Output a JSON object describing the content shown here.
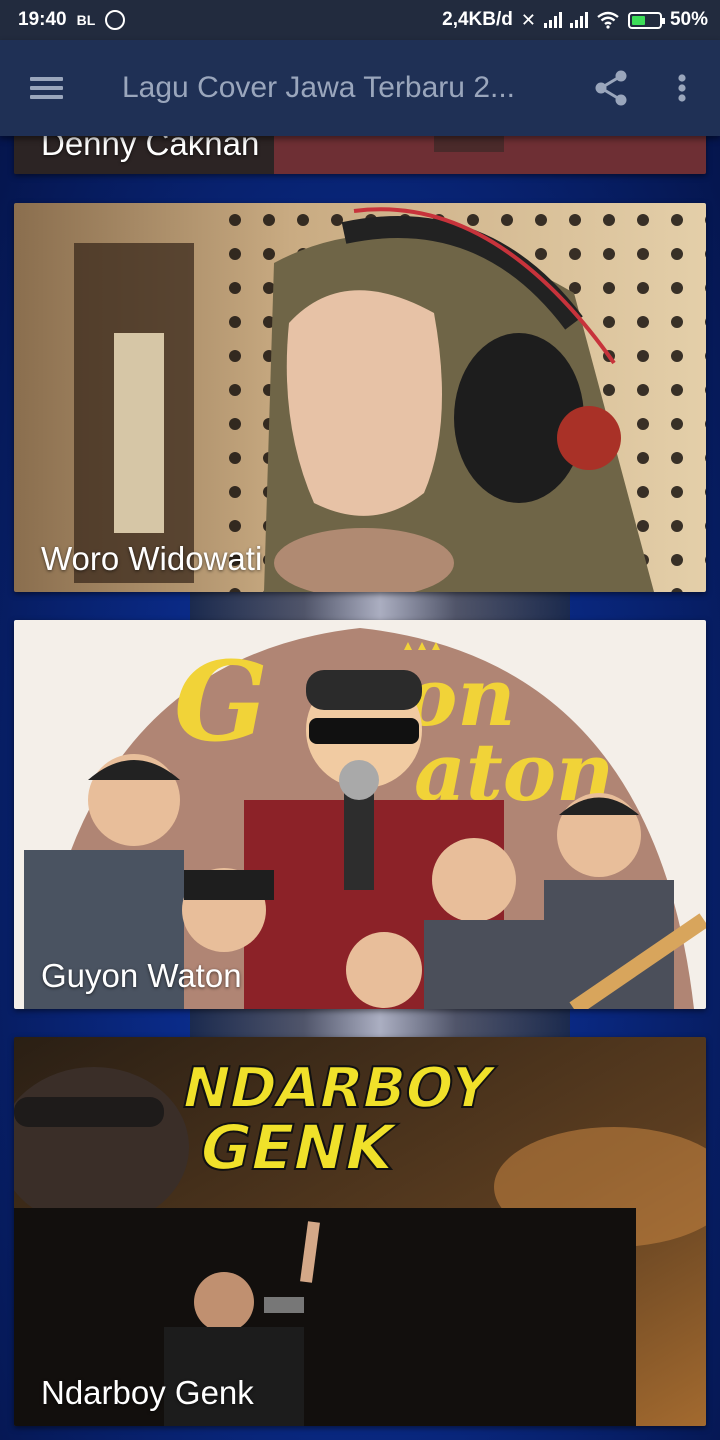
{
  "status_bar": {
    "time": "19:40",
    "carrier_badge": "BL",
    "whatsapp_icon": "whatsapp-icon",
    "network_speed": "2,4KB/d",
    "battery_percent": "50%",
    "battery_level": 0.5
  },
  "app_bar": {
    "title": "Lagu Cover Jawa Terbaru 2...",
    "menu_icon": "hamburger-menu-icon",
    "share_icon": "share-icon",
    "more_icon": "more-vert-icon"
  },
  "artists": [
    {
      "name": "Denny Caknan"
    },
    {
      "name": "Woro Widowati"
    },
    {
      "name": "Guyon Waton"
    },
    {
      "name": "Ndarboy Genk"
    }
  ],
  "colors": {
    "app_bar": "#1f3055",
    "status_bar": "#222b3e",
    "background": "#0a2a86",
    "title_text": "#9aa6bc"
  }
}
